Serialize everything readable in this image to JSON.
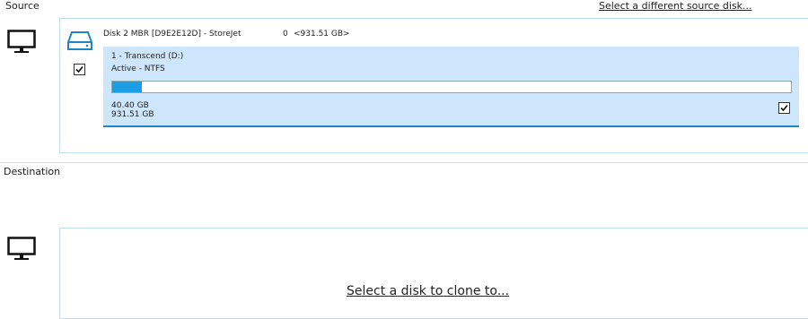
{
  "source": {
    "title": "Source",
    "change_link": "Select a different source disk...",
    "disk": {
      "name": "Disk 2 MBR [D9E2E12D] - StoreJet",
      "index": "0",
      "size": "<931.51 GB>",
      "checked": true
    },
    "partition": {
      "name": "1 - Transcend (D:)",
      "info": "Active - NTFS",
      "used": "40.40 GB",
      "total": "931.51 GB",
      "used_fraction": 0.0434,
      "checked": true
    }
  },
  "destination": {
    "title": "Destination",
    "select_link": "Select a disk to clone to..."
  },
  "colors": {
    "accent": "#1f86c3",
    "partition_bg": "#cde6fb",
    "usage_fill": "#1b9ee6",
    "frame_border": "#bfe0ea"
  },
  "icons": {
    "source_computer": "monitor-icon",
    "destination_computer": "monitor-icon",
    "disk": "hard-drive-icon",
    "check": "checkmark-icon"
  }
}
